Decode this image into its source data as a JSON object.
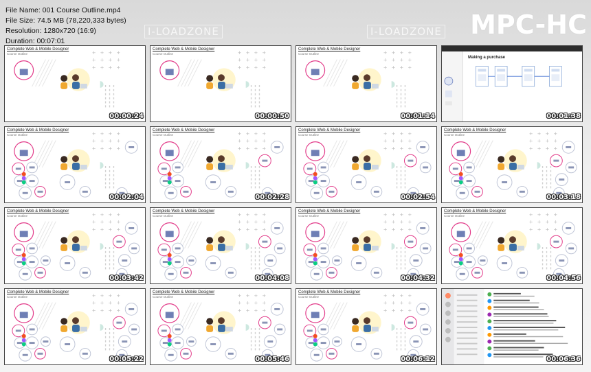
{
  "file_info": {
    "file_name": "File Name: 001 Course Outline.mp4",
    "file_size": "File Size: 74.5 MB (78,220,333 bytes)",
    "resolution": "Resolution: 1280x720 (16:9)",
    "duration": "Duration: 00:07:01"
  },
  "watermark": "I-LOADZONE",
  "player_logo": "MPC-HC",
  "slide": {
    "title": "Complete Web & Mobile Designer",
    "subtitle": "Course Outline"
  },
  "figma_heading": "Making a purchase",
  "thumbnails": [
    {
      "timestamp": "00:00:24",
      "kind": "intro"
    },
    {
      "timestamp": "00:00:50",
      "kind": "intro"
    },
    {
      "timestamp": "00:01:14",
      "kind": "intro"
    },
    {
      "timestamp": "00:01:38",
      "kind": "figma"
    },
    {
      "timestamp": "00:02:04",
      "kind": "bubbles"
    },
    {
      "timestamp": "00:02:28",
      "kind": "bubbles"
    },
    {
      "timestamp": "00:02:54",
      "kind": "bubbles"
    },
    {
      "timestamp": "00:03:18",
      "kind": "bubbles"
    },
    {
      "timestamp": "00:03:42",
      "kind": "bubbles"
    },
    {
      "timestamp": "00:04:08",
      "kind": "bubbles"
    },
    {
      "timestamp": "00:04:32",
      "kind": "bubbles"
    },
    {
      "timestamp": "00:04:56",
      "kind": "bubbles"
    },
    {
      "timestamp": "00:05:22",
      "kind": "bubbles"
    },
    {
      "timestamp": "00:05:46",
      "kind": "bubbles"
    },
    {
      "timestamp": "00:06:12",
      "kind": "bubbles"
    },
    {
      "timestamp": "00:06:36",
      "kind": "chat"
    }
  ],
  "colors": {
    "accent_pink": "#e23c8a",
    "timestamp_text": "#ffffff",
    "figma_bar": "#2c2c2c"
  }
}
